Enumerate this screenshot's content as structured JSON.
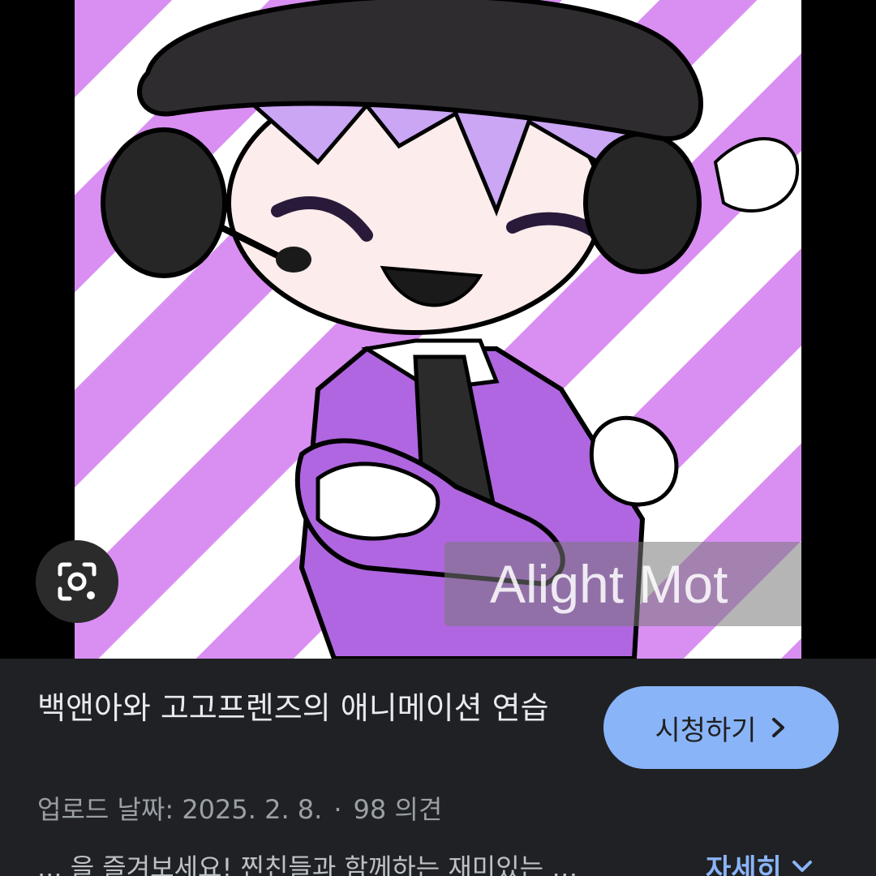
{
  "image": {
    "watermark_text": "Alight Mot",
    "stripe_color": "#d98ff2",
    "bg_color": "#ffffff"
  },
  "lens": {
    "icon": "camera-lens-icon"
  },
  "result": {
    "title": "백앤아와 고고프렌즈의 애니메이션 연습",
    "watch_label": "시청하기",
    "watch_icon": "chevron-right-icon",
    "upload_label": "업로드 날짜: 2025. 2. 8.",
    "separator": "·",
    "comments": "98 의견",
    "snippet": "... 을 즐겨보세요! 찐친들과 함께하는 재미있는 …",
    "more_label": "자세히",
    "more_icon": "chevron-down-icon",
    "accent": "#8ab4f8"
  }
}
